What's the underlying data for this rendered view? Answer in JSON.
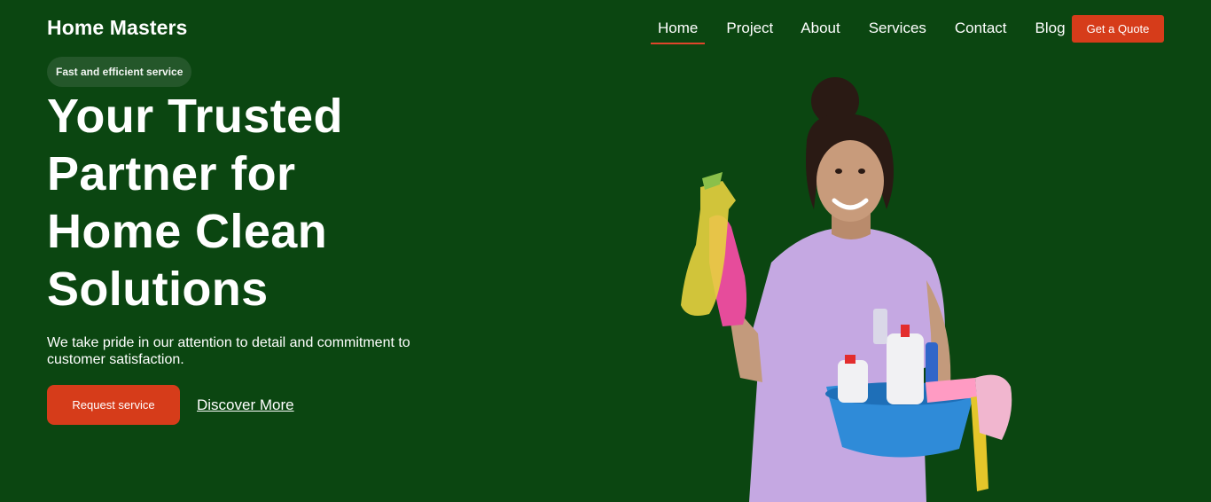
{
  "brand": {
    "name": "Home Masters"
  },
  "nav": {
    "items": [
      {
        "label": "Home",
        "active": true
      },
      {
        "label": "Project",
        "active": false
      },
      {
        "label": "About",
        "active": false
      },
      {
        "label": "Services",
        "active": false
      },
      {
        "label": "Contact",
        "active": false
      },
      {
        "label": "Blog",
        "active": false
      }
    ],
    "cta_label": "Get a Quote"
  },
  "hero": {
    "badge": "Fast and efficient service",
    "title_lines": [
      "Your Trusted",
      "Partner for",
      "Home Clean",
      "Solutions"
    ],
    "description": "We take pride in our attention to detail and commitment to customer satisfaction.",
    "primary_button": "Request service",
    "secondary_link": "Discover More",
    "image_icon": "cleaning-woman-illustration"
  },
  "colors": {
    "background": "#0b4611",
    "accent": "#d63c1a",
    "badge_bg": "#24572a",
    "text": "#ffffff"
  }
}
